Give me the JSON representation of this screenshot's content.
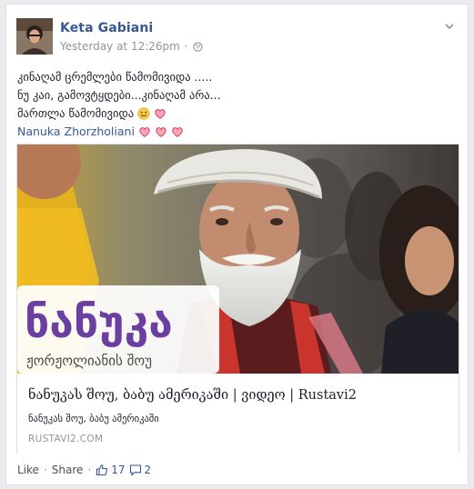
{
  "post": {
    "author": "Keta Gabiani",
    "timestamp": "Yesterday at 12:26pm",
    "separator": "·",
    "audience_icon": "globe-icon",
    "options_icon": "chevron-down-icon",
    "lines": [
      "კინაღამ ცრემლები წამომივიდა .....",
      "ნუ კაი, გამოვტყდები...კინაღამ არა...",
      "მართლა წამომივიდა"
    ],
    "tag": "Nanuka Zhorzholiani",
    "emoji_icons": [
      "smile-emoji-icon",
      "heart-icon"
    ]
  },
  "card": {
    "logo_main": "ნანუკა",
    "logo_sub": "ჟორჟოლიანის შოუ",
    "title": "ნანუკას შოუ, ბაბუ ამერიკაში | ვიდეო | Rustavi2",
    "subtitle": "ნანუკას შოუ, ბაბუ ამერიკაში",
    "domain": "RUSTAVI2.COM"
  },
  "actions": {
    "like": "Like",
    "dot": "·",
    "share": "Share",
    "likes_count": "17",
    "comments_count": "2"
  },
  "colors": {
    "link": "#365899",
    "secondary": "#90949c",
    "heart": "#e0245e",
    "logo_purple": "#6b3fa0"
  }
}
